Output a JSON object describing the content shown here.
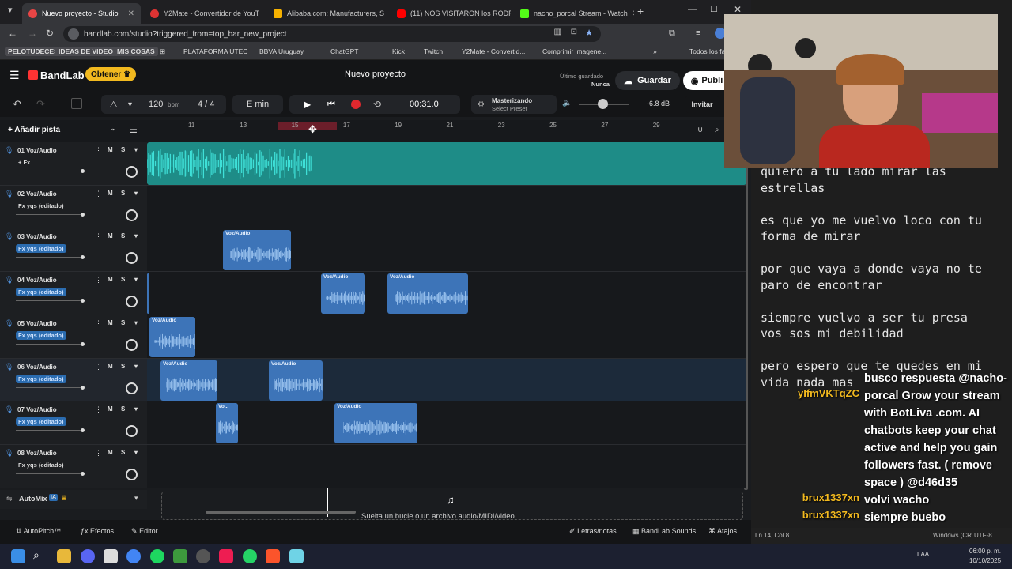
{
  "browser": {
    "tabs": [
      {
        "title": "Nuevo proyecto - Studio",
        "active": true,
        "color": "#e84545"
      },
      {
        "title": "Y2Mate - Convertidor de YouT",
        "active": false,
        "color": "#d33"
      },
      {
        "title": "Alibaba.com: Manufacturers, S",
        "active": false,
        "color": "#f6b100"
      },
      {
        "title": "(11) NOS VISITARON los RODR",
        "active": false,
        "color": "#f00"
      },
      {
        "title": "nacho_porcal Stream - Watch",
        "active": false,
        "color": "#53fc18"
      }
    ],
    "url": "bandlab.com/studio?triggered_from=top_bar_new_project",
    "bookmarks": [
      "PELOTUDECES",
      "IDEAS DE VIDEO",
      "MIS COSAS",
      "PLATAFORMA UTEC",
      "BBVA Uruguay",
      "ChatGPT",
      "Kick",
      "Twitch",
      "Y2Mate - Convertid...",
      "Comprimir imagene...",
      "Todos los fa"
    ]
  },
  "app": {
    "brand": "BandLab",
    "get_button": "Obtener",
    "project_title": "Nuevo proyecto",
    "last_saved_label": "Último guardado",
    "last_saved_value": "Nunca",
    "save_button": "Guardar",
    "publish_button": "Publi",
    "tempo": "120",
    "tempo_unit": "bpm",
    "time_sig": "4 / 4",
    "key": "E min",
    "time": "00:31.0",
    "mastering_label": "Masterizando",
    "mastering_preset": "Select Preset",
    "volume_db": "-6.8 dB",
    "invite_button": "Invitar",
    "add_track": "Añadir pista",
    "ruler": [
      "11",
      "13",
      "15",
      "17",
      "19",
      "21",
      "23",
      "25",
      "27",
      "29"
    ],
    "drop_hint": "Suelta un bucle o un archivo audio/MIDI/video",
    "automix": "AutoMix",
    "automix_badge": "IA",
    "bottom": {
      "autopitch": "AutoPitch™",
      "effects": "Efectos",
      "editor": "Editor",
      "lyrics": "Letras/notas",
      "sounds": "BandLab Sounds",
      "shortcuts": "Atajos"
    }
  },
  "tracks": [
    {
      "name": "01  Voz/Audio",
      "fx": "+ Fx",
      "fx_blue": false,
      "vol": 0.98
    },
    {
      "name": "02  Voz/Audio",
      "fx": "Fx yqs (editado)",
      "fx_blue": false,
      "vol": 0.98
    },
    {
      "name": "03  Voz/Audio",
      "fx": "Fx yqs (editado)",
      "fx_blue": true,
      "vol": 0.98
    },
    {
      "name": "04  Voz/Audio",
      "fx": "Fx yqs (editado)",
      "fx_blue": true,
      "vol": 0.98
    },
    {
      "name": "05  Voz/Audio",
      "fx": "Fx yqs (editado)",
      "fx_blue": true,
      "vol": 0.98
    },
    {
      "name": "06  Voz/Audio",
      "fx": "Fx yqs (editado)",
      "fx_blue": true,
      "vol": 0.98
    },
    {
      "name": "07  Voz/Audio",
      "fx": "Fx yqs (editado)",
      "fx_blue": true,
      "vol": 0.98
    },
    {
      "name": "08  Voz/Audio",
      "fx": "Fx yqs (editado)",
      "fx_blue": false,
      "vol": 0.98
    }
  ],
  "clip_label": "Voz/Audio",
  "clip_label_short": "Vo...",
  "lyrics": "quiero a tu lado mirar las\nestrellas\n\nes que yo me vuelvo loco con tu\nforma de mirar\n\npor que vaya a donde vaya no te\nparo de encontrar\n\nsiempre vuelvo a ser tu presa\nvos sos mi debilidad\n\npero espero que te quedes en mi\nvida nada mas",
  "editor_status": {
    "pos": "Ln 14, Col 8",
    "os": "Windows (CR",
    "enc": "UTF-8"
  },
  "chat": [
    {
      "user": "yIfmVKTqZC",
      "msg": "busco respuesta @nacho-porcal Grow your stream with BotLiva .com. AI chatbots keep your chat active and help you gain followers fast. ( remove space ) @d46d35"
    },
    {
      "user": "brux1337xn",
      "msg": "volvi wacho"
    },
    {
      "user": "brux1337xn",
      "msg": "siempre buebo"
    }
  ],
  "clock": {
    "time": "06:00 p. m.",
    "date": "10/10/2025",
    "lang": "LAA"
  }
}
